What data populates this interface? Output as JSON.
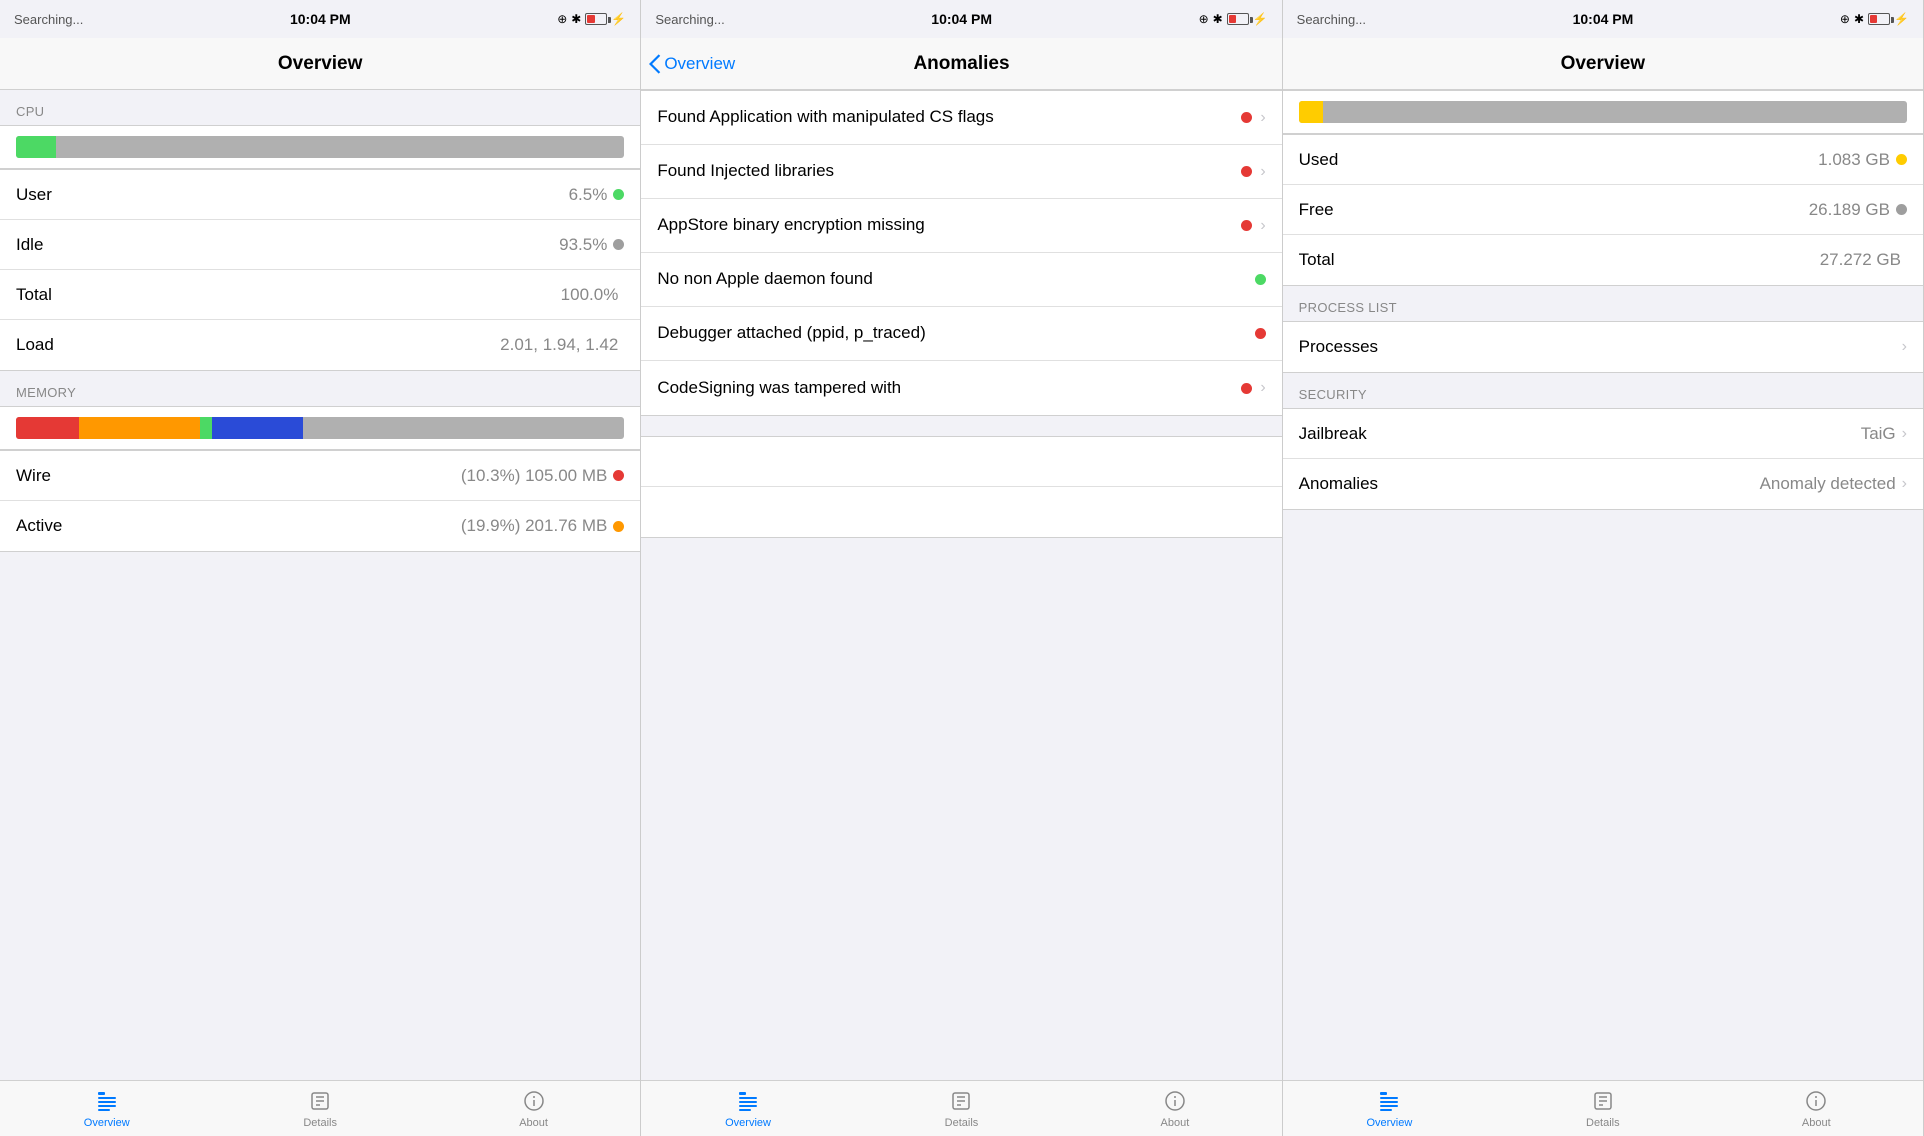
{
  "screens": [
    {
      "id": "screen1",
      "statusBar": {
        "left": "Searching...",
        "center": "10:04 PM"
      },
      "navTitle": "Overview",
      "navBack": null,
      "sections": [
        {
          "type": "section-header",
          "label": "CPU"
        },
        {
          "type": "cpu-bar"
        },
        {
          "type": "rows",
          "rows": [
            {
              "label": "User",
              "value": "6.5%",
              "dot": "green"
            },
            {
              "label": "Idle",
              "value": "93.5%",
              "dot": "gray"
            },
            {
              "label": "Total",
              "value": "100.0%",
              "dot": null
            },
            {
              "label": "Load",
              "value": "2.01, 1.94, 1.42",
              "dot": null
            }
          ]
        },
        {
          "type": "section-header",
          "label": "MEMORY"
        },
        {
          "type": "memory-bar"
        },
        {
          "type": "rows",
          "rows": [
            {
              "label": "Wire",
              "value": "(10.3%) 105.00 MB",
              "dot": "red"
            },
            {
              "label": "Active",
              "value": "(19.9%) 201.76 MB",
              "dot": "orange"
            }
          ]
        }
      ],
      "tabs": [
        {
          "label": "Overview",
          "active": true,
          "icon": "overview"
        },
        {
          "label": "Details",
          "active": false,
          "icon": "details"
        },
        {
          "label": "About",
          "active": false,
          "icon": "about"
        }
      ]
    },
    {
      "id": "screen2",
      "statusBar": {
        "left": "Searching...",
        "center": "10:04 PM"
      },
      "navTitle": "Anomalies",
      "navBack": "Overview",
      "anomalies": [
        {
          "text": "Found Application with manipulated CS flags",
          "dot": "red",
          "chevron": true
        },
        {
          "text": "Found Injected libraries",
          "dot": "red",
          "chevron": true
        },
        {
          "text": "AppStore binary encryption missing",
          "dot": "red",
          "chevron": true
        },
        {
          "text": "No non Apple daemon found",
          "dot": "green",
          "chevron": false
        },
        {
          "text": "Debugger attached (ppid, p_traced)",
          "dot": "red",
          "chevron": false
        },
        {
          "text": "CodeSigning was tampered with",
          "dot": "red",
          "chevron": true
        }
      ],
      "blankRows": 2,
      "tabs": [
        {
          "label": "Overview",
          "active": true,
          "icon": "overview"
        },
        {
          "label": "Details",
          "active": false,
          "icon": "details"
        },
        {
          "label": "About",
          "active": false,
          "icon": "about"
        }
      ]
    },
    {
      "id": "screen3",
      "statusBar": {
        "left": "Searching...",
        "center": "10:04 PM"
      },
      "navTitle": "Overview",
      "navBack": null,
      "storageRows": [
        {
          "label": "Used",
          "value": "1.083 GB",
          "dot": "yellow"
        },
        {
          "label": "Free",
          "value": "26.189 GB",
          "dot": "gray"
        },
        {
          "label": "Total",
          "value": "27.272 GB",
          "dot": null
        }
      ],
      "sectionHeaders": [
        {
          "id": "process-list",
          "label": "PROCESS LIST"
        },
        {
          "id": "security",
          "label": "SECURITY"
        }
      ],
      "processList": [
        {
          "label": "Processes",
          "value": "",
          "chevron": true
        }
      ],
      "securityRows": [
        {
          "label": "Jailbreak",
          "value": "TaiG",
          "chevron": true
        },
        {
          "label": "Anomalies",
          "value": "Anomaly detected",
          "chevron": true
        }
      ],
      "tabs": [
        {
          "label": "Overview",
          "active": true,
          "icon": "overview"
        },
        {
          "label": "Details",
          "active": false,
          "icon": "details"
        },
        {
          "label": "About",
          "active": false,
          "icon": "about"
        }
      ]
    }
  ]
}
